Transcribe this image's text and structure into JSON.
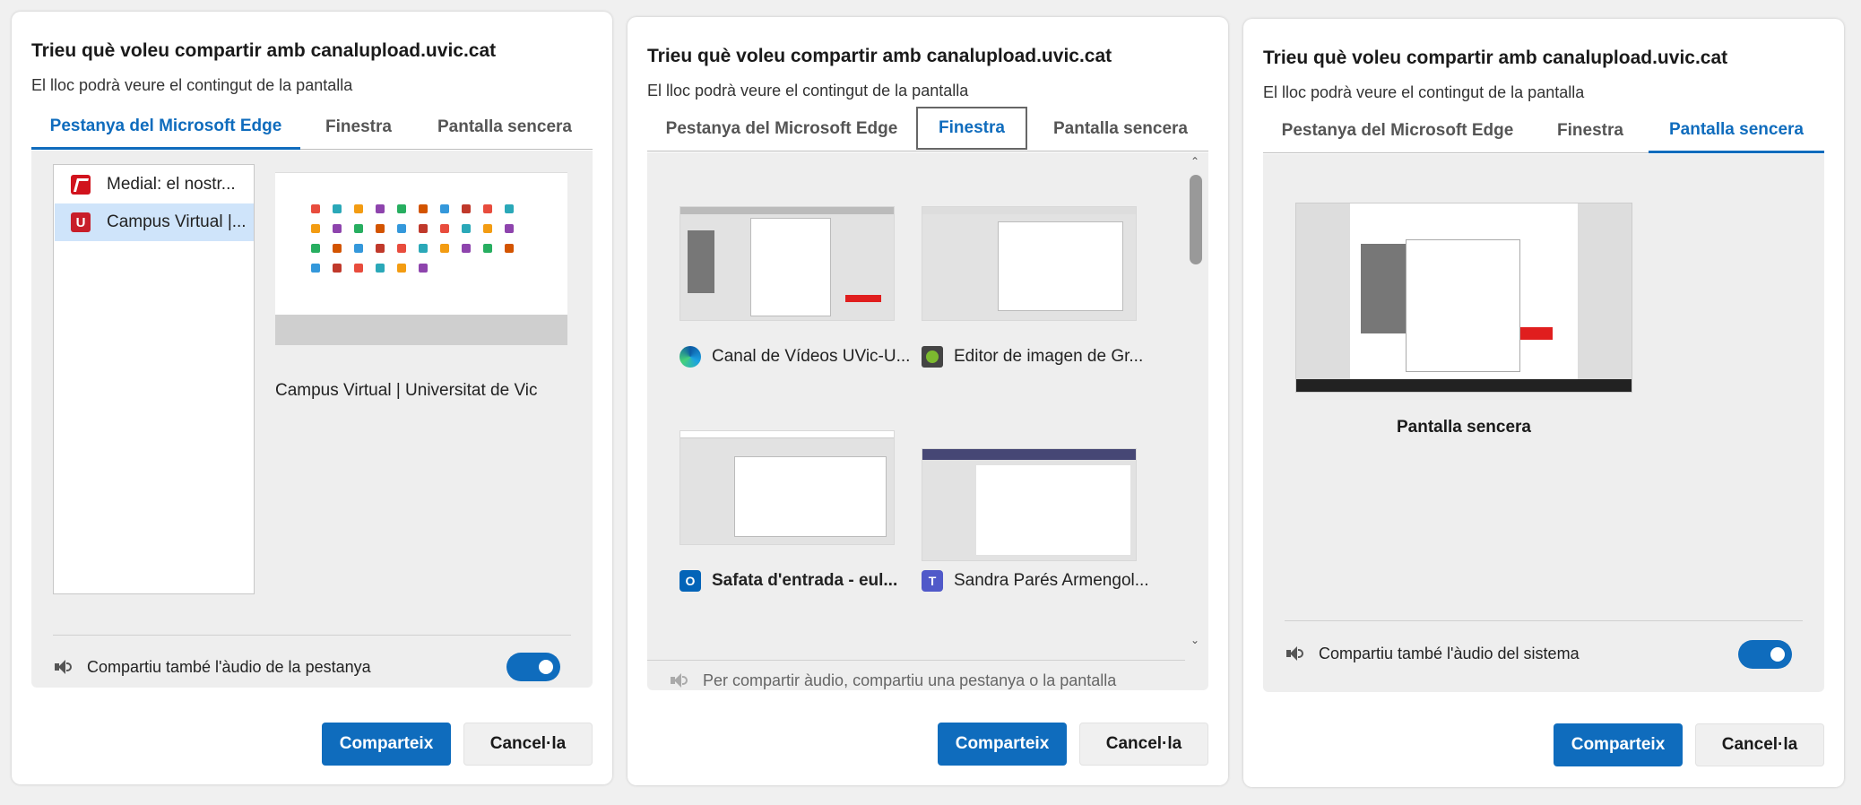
{
  "dialogs": [
    {
      "title": "Trieu què voleu compartir amb canalupload.uvic.cat",
      "subtitle": "El lloc podrà veure el contingut de la pantalla",
      "tabs": [
        "Pestanya del Microsoft Edge",
        "Finestra",
        "Pantalla sencera"
      ],
      "active_tab": 0,
      "tab_list": [
        {
          "label": "Medial: el nostr...",
          "icon": "medial-favicon",
          "selected": false
        },
        {
          "label": "Campus Virtual |...",
          "icon": "campus-virtual-favicon",
          "selected": true
        }
      ],
      "preview_caption": "Campus Virtual | Universitat de Vic",
      "audio_label": "Compartiu també l'àudio de la pestanya",
      "audio_enabled": true,
      "share_label": "Comparteix",
      "cancel_label": "Cancel·la"
    },
    {
      "title": "Trieu què voleu compartir amb canalupload.uvic.cat",
      "subtitle": "El lloc podrà veure el contingut de la pantalla",
      "tabs": [
        "Pestanya del Microsoft Edge",
        "Finestra",
        "Pantalla sencera"
      ],
      "active_tab": 1,
      "windows": [
        {
          "label": "Canal de Vídeos UVic-U...",
          "icon": "edge-icon",
          "bold": false
        },
        {
          "label": "Editor de imagen de Gr...",
          "icon": "gimp-icon",
          "bold": false
        },
        {
          "label": "Safata d'entrada - eul...",
          "icon": "outlook-icon",
          "bold": true
        },
        {
          "label": "Sandra Parés Armengol...",
          "icon": "teams-icon",
          "bold": false
        }
      ],
      "audio_label": "Per compartir àudio, compartiu una pestanya o la pantalla",
      "audio_enabled": false,
      "share_label": "Comparteix",
      "cancel_label": "Cancel·la"
    },
    {
      "title": "Trieu què voleu compartir amb canalupload.uvic.cat",
      "subtitle": "El lloc podrà veure el contingut de la pantalla",
      "tabs": [
        "Pestanya del Microsoft Edge",
        "Finestra",
        "Pantalla sencera"
      ],
      "active_tab": 2,
      "screen_caption": "Pantalla sencera",
      "audio_label": "Compartiu també l'àudio del sistema",
      "audio_enabled": true,
      "share_label": "Comparteix",
      "cancel_label": "Cancel·la"
    }
  ],
  "colors": {
    "accent": "#0f6cbd",
    "selected_row": "#cfe4fa",
    "panel_bg": "#eeeeee"
  }
}
